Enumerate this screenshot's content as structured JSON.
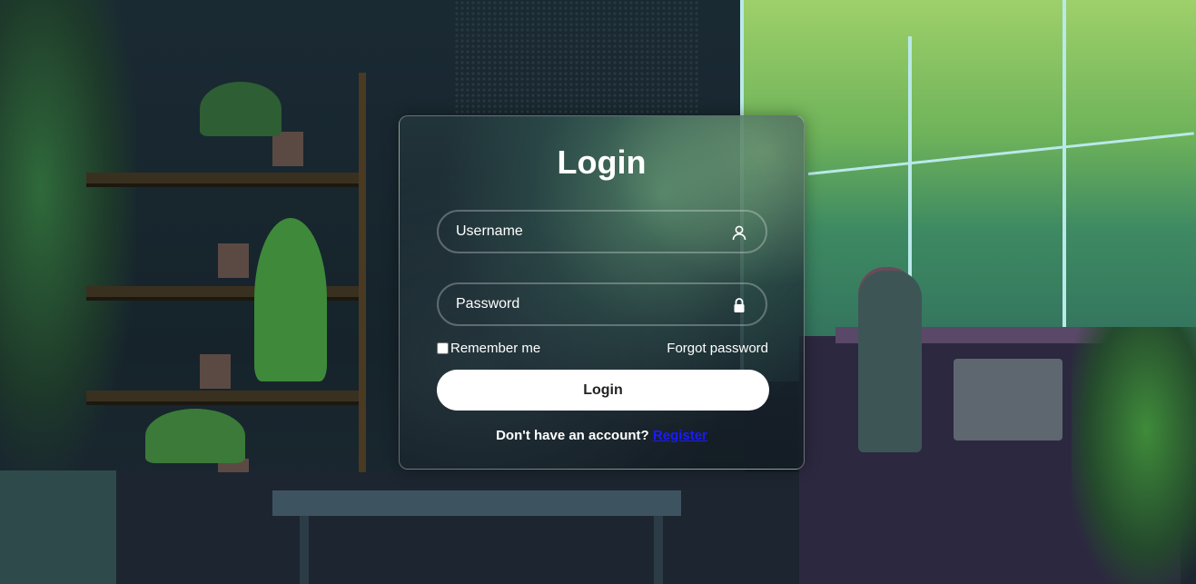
{
  "login_form": {
    "title": "Login",
    "username_placeholder": "Username",
    "password_placeholder": "Password",
    "remember_label": "Remember me",
    "remember_checked": false,
    "forgot_label": "Forgot password",
    "submit_label": "Login",
    "no_account_text": "Don't have an account?",
    "register_label": "Register"
  },
  "icons": {
    "username": "user-icon",
    "password": "lock-icon"
  },
  "colors": {
    "button_bg": "#ffffff",
    "button_text": "#222222",
    "link": "#1a1aff",
    "text": "#ffffff"
  }
}
